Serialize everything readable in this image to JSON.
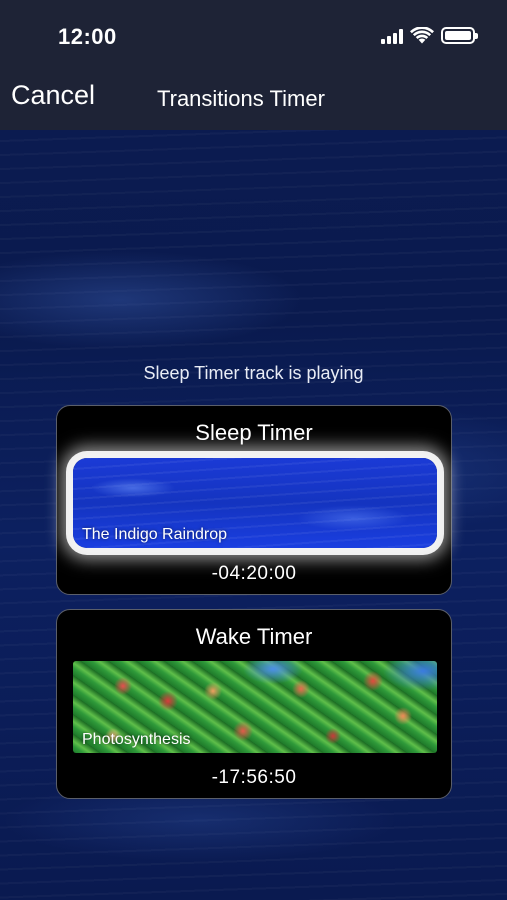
{
  "status_bar": {
    "time": "12:00",
    "icons": [
      "signal-icon",
      "wifi-icon",
      "battery-icon"
    ]
  },
  "nav": {
    "cancel_label": "Cancel",
    "title": "Transitions Timer"
  },
  "status_message": "Sleep Timer track is playing",
  "sleep_timer": {
    "title": "Sleep Timer",
    "track": "The Indigo Raindrop",
    "remaining": "-04:20:00"
  },
  "wake_timer": {
    "title": "Wake Timer",
    "track": "Photosynthesis",
    "remaining": "-17:56:50"
  },
  "colors": {
    "background": "#0b1a4a",
    "nav_bar": "#1e2336",
    "card_background": "#000000",
    "card_border": "#5b5f6a"
  }
}
